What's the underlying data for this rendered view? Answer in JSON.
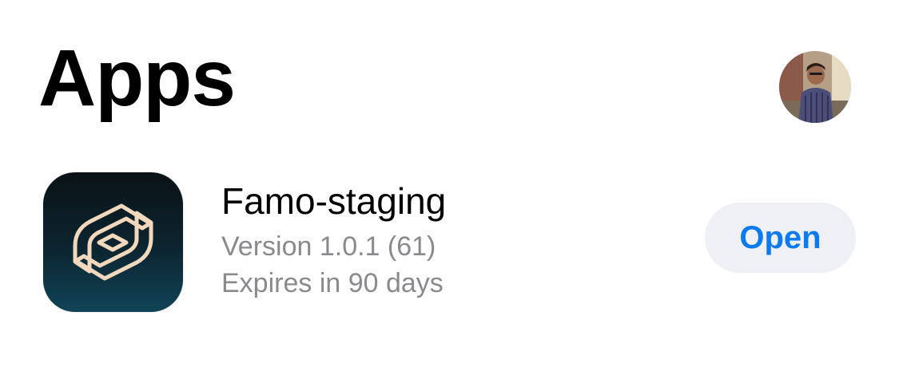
{
  "header": {
    "title": "Apps",
    "avatar_icon": "user-avatar-photo"
  },
  "apps": [
    {
      "name": "Famo-staging",
      "version": "Version 1.0.1 (61)",
      "expiry": "Expires in 90 days",
      "action_label": "Open",
      "icon": "famo-logo-icon"
    }
  ],
  "colors": {
    "accent": "#0a7af2",
    "button_bg": "#eff0f6",
    "secondary_text": "#8a8a8e",
    "app_icon_gradient": [
      "#0a1216",
      "#104356"
    ],
    "logo_stroke": "#f2d9bd"
  }
}
